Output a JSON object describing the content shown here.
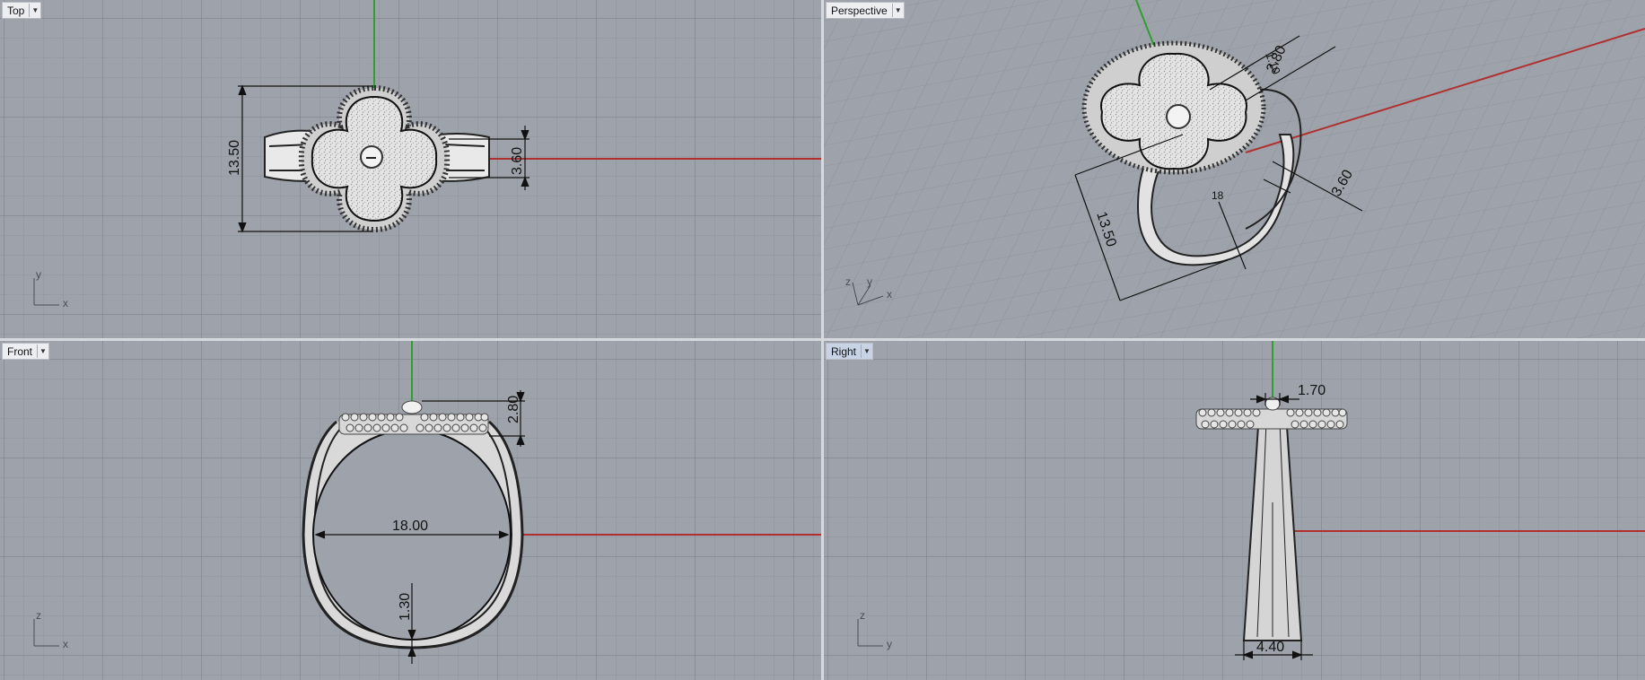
{
  "viewports": {
    "top": {
      "label": "Top",
      "dims": [
        "13.50",
        "3.60"
      ],
      "axes": [
        "y",
        "x"
      ]
    },
    "perspective": {
      "label": "Perspective",
      "dims": [
        "13.50",
        "3.60",
        "2.80",
        "1.10",
        "18"
      ],
      "axes": [
        "z",
        "y",
        "x"
      ]
    },
    "front": {
      "label": "Front",
      "dims": [
        "18.00",
        "2.80",
        "1.30"
      ],
      "axes": [
        "z",
        "x"
      ]
    },
    "right": {
      "label": "Right",
      "dims": [
        "1.70",
        "4.40"
      ],
      "axes": [
        "z",
        "y"
      ]
    }
  },
  "colors": {
    "background": "#9ea3ab",
    "grid_minor": "#8f949c",
    "grid_major": "#7b8088",
    "x_axis": "#b03030",
    "y_axis": "#2fa02f",
    "active_tab": "#c8d4e6"
  },
  "icons": {
    "viewport_menu": "triangle-down-icon"
  }
}
